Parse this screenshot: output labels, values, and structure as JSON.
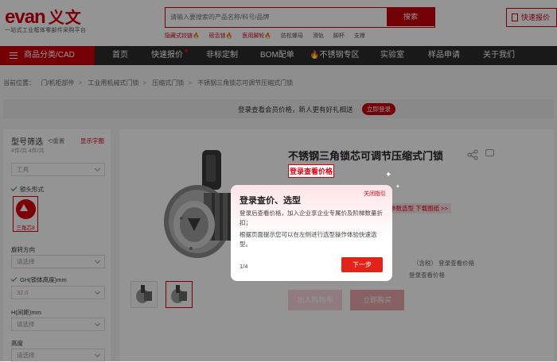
{
  "header": {
    "logo_text": "evan",
    "logo_cn": "义文",
    "slogan": "一站式工业框体零部件采购平台",
    "search_placeholder": "请输入要搜索的产品名称/料号/品牌",
    "search_button": "搜索",
    "hotwords": [
      {
        "text": "隐藏式铰链🔥",
        "hot": true
      },
      {
        "text": "磅舌锁🔥",
        "hot": true
      },
      {
        "text": "医用脚轮🔥",
        "hot": true
      },
      {
        "text": "防松螺母",
        "hot": false
      },
      {
        "text": "滑轨",
        "hot": false
      },
      {
        "text": "脚杯",
        "hot": false
      },
      {
        "text": "支撑",
        "hot": false
      }
    ],
    "quote_button": "快速报价"
  },
  "nav": {
    "category": "商品分类/CAD",
    "items": [
      "首页",
      "快速报价",
      "非标定制",
      "BOM配单",
      "🔥不锈钢专区",
      "实验室",
      "样品申请",
      "关于我们"
    ]
  },
  "breadcrumb": {
    "label": "当前位置：",
    "items": [
      "门/机柜部件",
      "工业用机械式门锁",
      "压缩式门锁",
      "不锈钢三角锁芯可调节压缩式门锁"
    ]
  },
  "loginbar": {
    "text": "登录查看会员价格，新人更有好礼相送",
    "button": "立即登录"
  },
  "filter": {
    "title": "型号筛选",
    "reset": "重置",
    "show_images": "显示字图",
    "count": "4件/共 4件/共",
    "top_select": "工具",
    "head_type_label": "锁头形式",
    "head_type_value": "三角芯8",
    "rotation_label": "旋转方向",
    "rotation_value": "请选择",
    "gh_label": "GH(锁体高度)mm",
    "gh_value": "32.0",
    "h_label": "H(间距)mm",
    "h_value": "请选择",
    "height_label": "高度",
    "height_value": "请选择"
  },
  "product": {
    "name": "不锈钢三角锁芯可调节压缩式门锁",
    "login_price": "登录查看价格",
    "cad_tag": "参数选型 下载图纸 >>",
    "mini1": "（含税）  登录查看价格",
    "mini2": "登录查看价格",
    "add_cart": "加入购物车",
    "buy_now": "立即购买"
  },
  "dialog": {
    "title": "登录查价、选型",
    "close": "关闭指引",
    "para1": "登录后查看价格，加入企业享企业专属价及阶梯数量折扣；",
    "para2": "根据页面提示您可以在左侧进行选型操作体验快速选型。",
    "step": "1/4",
    "next": "下一步"
  }
}
